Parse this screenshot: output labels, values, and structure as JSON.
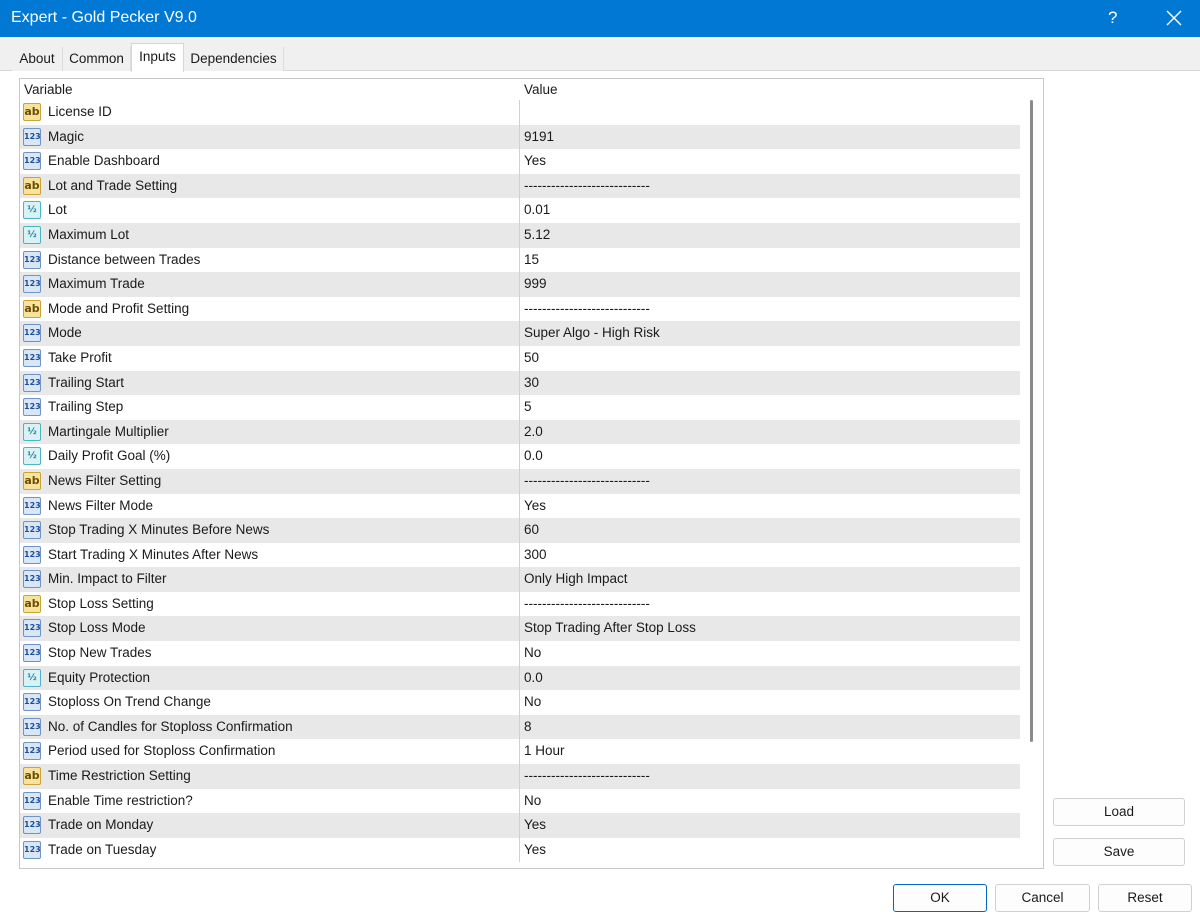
{
  "window": {
    "title": "Expert - Gold Pecker V9.0",
    "help_label": "?"
  },
  "tabs": [
    {
      "label": "About"
    },
    {
      "label": "Common"
    },
    {
      "label": "Inputs",
      "active": true
    },
    {
      "label": "Dependencies"
    }
  ],
  "grid": {
    "columns": [
      "Variable",
      "Value"
    ],
    "rows": [
      {
        "icon": "ab",
        "name": "License ID",
        "value": ""
      },
      {
        "icon": "123",
        "name": "Magic",
        "value": "9191"
      },
      {
        "icon": "123",
        "name": "Enable Dashboard",
        "value": "Yes"
      },
      {
        "icon": "ab",
        "name": "Lot and Trade Setting",
        "value": "----------------------------"
      },
      {
        "icon": "1/2",
        "name": "Lot",
        "value": "0.01"
      },
      {
        "icon": "1/2",
        "name": "Maximum Lot",
        "value": "5.12"
      },
      {
        "icon": "123",
        "name": "Distance between Trades",
        "value": "15"
      },
      {
        "icon": "123",
        "name": "Maximum Trade",
        "value": "999"
      },
      {
        "icon": "ab",
        "name": "Mode and Profit Setting",
        "value": "----------------------------"
      },
      {
        "icon": "123",
        "name": "Mode",
        "value": "Super Algo - High Risk"
      },
      {
        "icon": "123",
        "name": "Take Profit",
        "value": "50"
      },
      {
        "icon": "123",
        "name": "Trailing Start",
        "value": "30"
      },
      {
        "icon": "123",
        "name": "Trailing Step",
        "value": "5"
      },
      {
        "icon": "1/2",
        "name": "Martingale Multiplier",
        "value": "2.0"
      },
      {
        "icon": "1/2",
        "name": "Daily Profit Goal (%)",
        "value": "0.0"
      },
      {
        "icon": "ab",
        "name": "News Filter Setting",
        "value": "----------------------------"
      },
      {
        "icon": "123",
        "name": "News Filter Mode",
        "value": "Yes"
      },
      {
        "icon": "123",
        "name": "Stop Trading X Minutes Before News",
        "value": "60"
      },
      {
        "icon": "123",
        "name": "Start Trading X Minutes After News",
        "value": "300"
      },
      {
        "icon": "123",
        "name": "Min. Impact to Filter",
        "value": "Only High Impact"
      },
      {
        "icon": "ab",
        "name": "Stop Loss Setting",
        "value": "----------------------------"
      },
      {
        "icon": "123",
        "name": "Stop Loss Mode",
        "value": "Stop Trading After Stop Loss"
      },
      {
        "icon": "123",
        "name": "Stop New Trades",
        "value": "No"
      },
      {
        "icon": "1/2",
        "name": "Equity Protection",
        "value": "0.0"
      },
      {
        "icon": "123",
        "name": "Stoploss On Trend Change",
        "value": "No"
      },
      {
        "icon": "123",
        "name": "No. of Candles for Stoploss Confirmation",
        "value": "8"
      },
      {
        "icon": "123",
        "name": "Period used for Stoploss Confirmation",
        "value": "1 Hour"
      },
      {
        "icon": "ab",
        "name": "Time Restriction Setting",
        "value": "----------------------------"
      },
      {
        "icon": "123",
        "name": "Enable Time restriction?",
        "value": "No"
      },
      {
        "icon": "123",
        "name": "Trade on Monday",
        "value": "Yes"
      },
      {
        "icon": "123",
        "name": "Trade on Tuesday",
        "value": "Yes"
      }
    ]
  },
  "side_buttons": {
    "load": "Load",
    "save": "Save"
  },
  "footer_buttons": {
    "ok": "OK",
    "cancel": "Cancel",
    "reset": "Reset"
  }
}
